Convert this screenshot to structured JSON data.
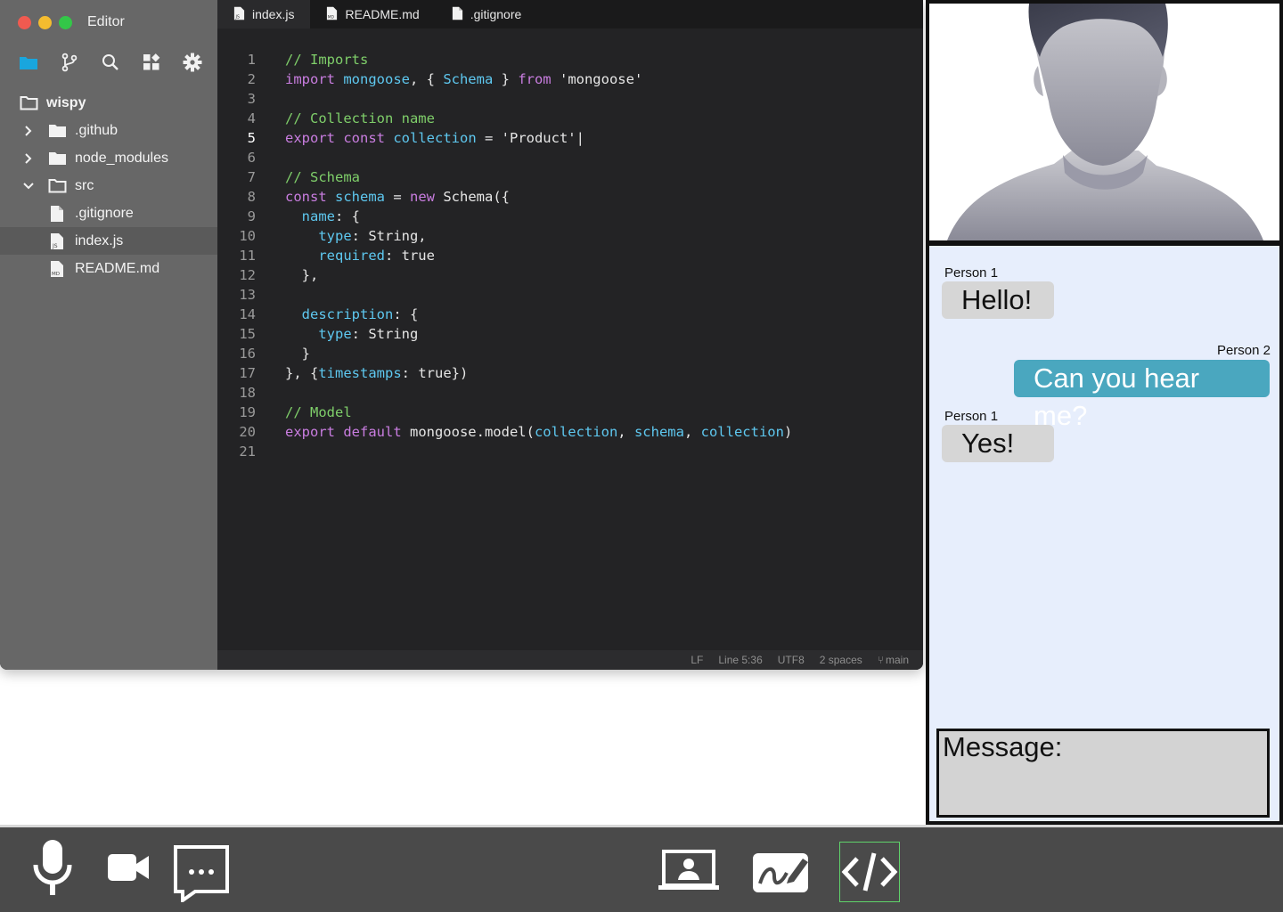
{
  "window": {
    "title": "Editor"
  },
  "colors": {
    "accent_folder": "#19a6de",
    "traffic_red": "#f05a50",
    "traffic_yellow": "#f4bc2f",
    "traffic_green": "#33c748",
    "active_tool_border": "#5fd36a",
    "outgoing_bubble": "#4aa7bf"
  },
  "sidebar": {
    "tools": [
      "folder-icon",
      "git-branch-icon",
      "search-icon",
      "extensions-icon",
      "gear-icon"
    ],
    "tree": [
      {
        "label": "wispy",
        "type": "root-folder"
      },
      {
        "label": ".github",
        "type": "folder",
        "expanded": false
      },
      {
        "label": "node_modules",
        "type": "folder",
        "expanded": false
      },
      {
        "label": "src",
        "type": "folder",
        "expanded": true
      },
      {
        "label": ".gitignore",
        "type": "file"
      },
      {
        "label": "index.js",
        "type": "file-js",
        "selected": true
      },
      {
        "label": "README.md",
        "type": "file-md"
      }
    ]
  },
  "tabs": [
    {
      "label": "index.js",
      "icon": "js-file-icon",
      "active": true
    },
    {
      "label": "README.md",
      "icon": "md-file-icon",
      "active": false
    },
    {
      "label": ".gitignore",
      "icon": "file-icon",
      "active": false
    }
  ],
  "code": {
    "current_line": 5,
    "lines": [
      [
        [
          "// Imports",
          "com"
        ]
      ],
      [
        [
          "import ",
          "kw"
        ],
        [
          "mongoose",
          "id"
        ],
        [
          ", { ",
          ""
        ],
        [
          "Schema",
          "id"
        ],
        [
          " } ",
          ""
        ],
        [
          "from ",
          "kw"
        ],
        [
          "'mongoose'",
          ""
        ]
      ],
      [],
      [
        [
          "// Collection name",
          "com"
        ]
      ],
      [
        [
          "export const ",
          "kw"
        ],
        [
          "collection",
          "id"
        ],
        [
          " = 'Product'|",
          ""
        ]
      ],
      [],
      [
        [
          "// Schema",
          "com"
        ]
      ],
      [
        [
          "const ",
          "kw"
        ],
        [
          "schema",
          "id"
        ],
        [
          " = ",
          ""
        ],
        [
          "new ",
          "kw"
        ],
        [
          "Schema({",
          ""
        ]
      ],
      [
        [
          "  ",
          ""
        ],
        [
          "name",
          "id"
        ],
        [
          ": {",
          ""
        ]
      ],
      [
        [
          "    ",
          ""
        ],
        [
          "type",
          "id"
        ],
        [
          ": String,",
          ""
        ]
      ],
      [
        [
          "    ",
          ""
        ],
        [
          "required",
          "id"
        ],
        [
          ": true",
          ""
        ]
      ],
      [
        [
          "  },",
          ""
        ]
      ],
      [],
      [
        [
          "  ",
          ""
        ],
        [
          "description",
          "id"
        ],
        [
          ": {",
          ""
        ]
      ],
      [
        [
          "    ",
          ""
        ],
        [
          "type",
          "id"
        ],
        [
          ": String",
          ""
        ]
      ],
      [
        [
          "  }",
          ""
        ]
      ],
      [
        [
          "}, {",
          ""
        ],
        [
          "timestamps",
          "id"
        ],
        [
          ": true})",
          ""
        ]
      ],
      [],
      [
        [
          "// Model",
          "com"
        ]
      ],
      [
        [
          "export default ",
          "kw"
        ],
        [
          "mongoose.model(",
          ""
        ],
        [
          "collection",
          "id"
        ],
        [
          ", ",
          ""
        ],
        [
          "schema",
          "id"
        ],
        [
          ", ",
          ""
        ],
        [
          "collection",
          "id"
        ],
        [
          ")",
          ""
        ]
      ],
      []
    ]
  },
  "status": {
    "eol": "LF",
    "position": "Line 5:36",
    "encoding": "UTF8",
    "indent": "2 spaces",
    "branch": "main"
  },
  "chat": {
    "messages": [
      {
        "sender": "Person 1",
        "text": "Hello!",
        "direction": "in"
      },
      {
        "sender": "Person 2",
        "text": "Can you hear me?",
        "direction": "out"
      },
      {
        "sender": "Person 1",
        "text": "Yes!",
        "direction": "in"
      }
    ],
    "input_label": "Message:"
  },
  "toolbar": {
    "left": [
      "microphone-icon",
      "video-camera-icon",
      "chat-icon"
    ],
    "right": [
      "screen-share-icon",
      "whiteboard-icon",
      "code-editor-icon"
    ],
    "active": "code-editor-icon"
  }
}
